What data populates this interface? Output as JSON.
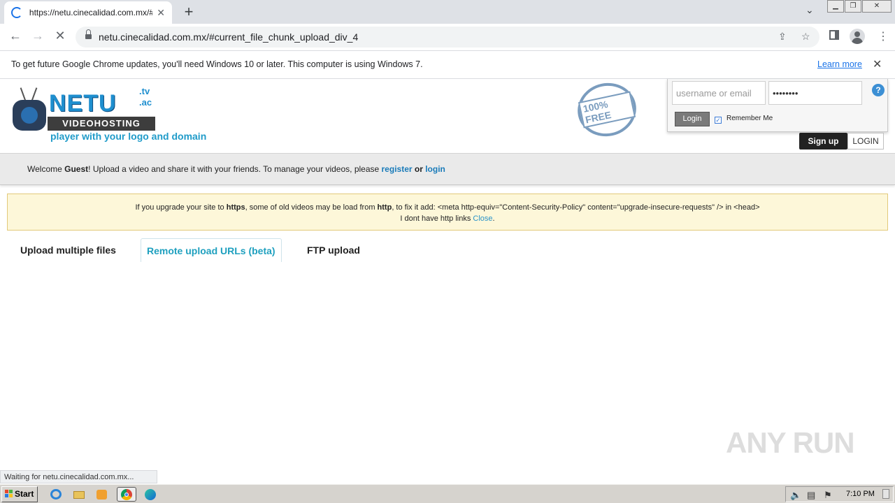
{
  "browser": {
    "tab_title": "https://netu.cinecalidad.com.mx/#c",
    "tab_close": "✕",
    "new_tab": "+",
    "url": "netu.cinecalidad.com.mx/#current_file_chunk_upload_div_4",
    "infobar_message": "To get future Google Chrome updates, you'll need Windows 10 or later. This computer is using Windows 7.",
    "infobar_link": "Learn more"
  },
  "site": {
    "logo_name": "NETU",
    "logo_sub": "VIDEOHOSTING",
    "tld_tv": ".tv",
    "tld_ac": ".ac",
    "tagline": "player with your logo and domain",
    "stamp_text": "100% FREE"
  },
  "login": {
    "username_placeholder": "username or email",
    "password_value": "••••••••",
    "help": "?",
    "login_button": "Login",
    "remember_label": "Remember Me",
    "signup_button": "Sign up",
    "login_tab": "LOGIN"
  },
  "welcome": {
    "prefix": "Welcome ",
    "user": "Guest",
    "middle": "! Upload a video and share it with your friends. To manage your videos, please ",
    "register": "register",
    "or": " or ",
    "login": "login"
  },
  "notice": {
    "line1_a": "If you upgrade your site to ",
    "https": "https",
    "line1_b": ", some of old videos may be load from ",
    "http": "http",
    "line1_c": ", to fix it add: <meta http-equiv=\"Content-Security-Policy\" content=\"upgrade-insecure-requests\" /> in <head>",
    "line2": "I dont have http links ",
    "close": "Close",
    "period": "."
  },
  "upload_tabs": [
    {
      "label": "Upload multiple files",
      "active": false
    },
    {
      "label": "Remote upload URLs (beta)",
      "active": true
    },
    {
      "label": "FTP upload",
      "active": false
    }
  ],
  "status_bar": "Waiting for netu.cinecalidad.com.mx...",
  "watermark": "ANY RUN",
  "taskbar": {
    "start": "Start",
    "clock": "7:10 PM"
  }
}
